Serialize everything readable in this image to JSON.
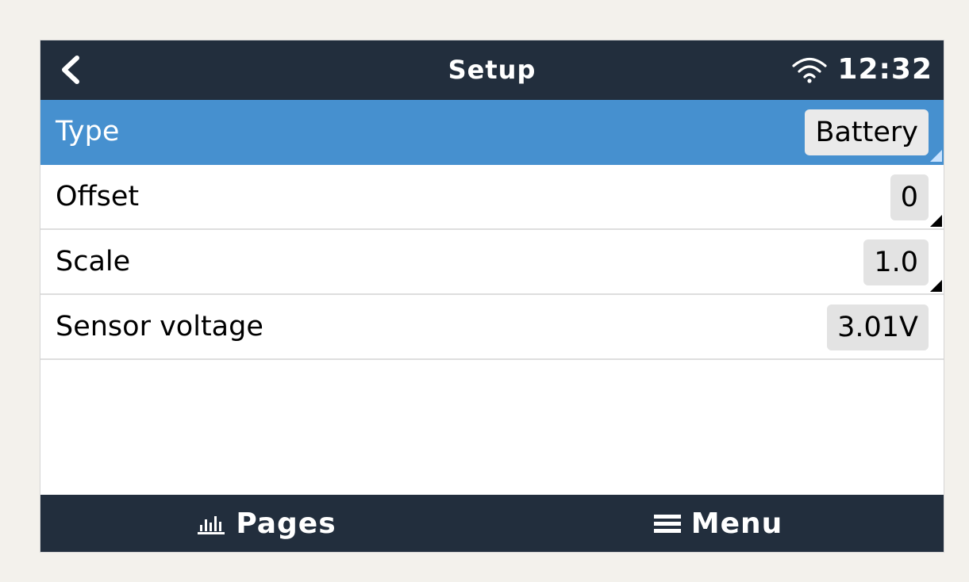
{
  "header": {
    "back_icon": "chevron-left-icon",
    "title": "Setup",
    "wifi_icon": "wifi-icon",
    "time": "12:32"
  },
  "rows": [
    {
      "label": "Type",
      "value": "Battery",
      "selected": true,
      "editable": true
    },
    {
      "label": "Offset",
      "value": "0",
      "selected": false,
      "editable": true
    },
    {
      "label": "Scale",
      "value": "1.0",
      "selected": false,
      "editable": true
    },
    {
      "label": "Sensor voltage",
      "value": "3.01V",
      "selected": false,
      "editable": false
    }
  ],
  "footer": {
    "pages_label": "Pages",
    "pages_icon": "bar-chart-icon",
    "menu_label": "Menu",
    "menu_icon": "hamburger-menu-icon"
  },
  "colors": {
    "header_bg": "#222e3d",
    "selected_bg": "#4690cf",
    "value_box_bg": "#e3e3e3"
  }
}
